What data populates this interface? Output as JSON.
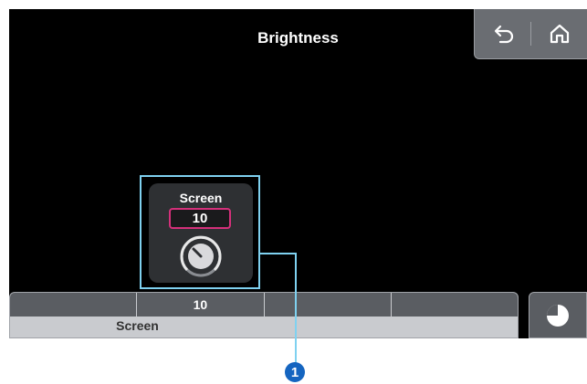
{
  "header": {
    "title": "Brightness"
  },
  "nav": {
    "back_icon": "undo-arrow-icon",
    "home_icon": "home-icon"
  },
  "knob": {
    "label": "Screen",
    "value": "10",
    "value_border_color": "#d4307a"
  },
  "strip": {
    "cells": [
      "",
      "10",
      "",
      ""
    ],
    "label": "Screen"
  },
  "timer": {
    "icon": "timer-icon"
  },
  "callout": {
    "number": "1",
    "color": "#1565c0",
    "highlight_color": "#7fd1f0"
  }
}
